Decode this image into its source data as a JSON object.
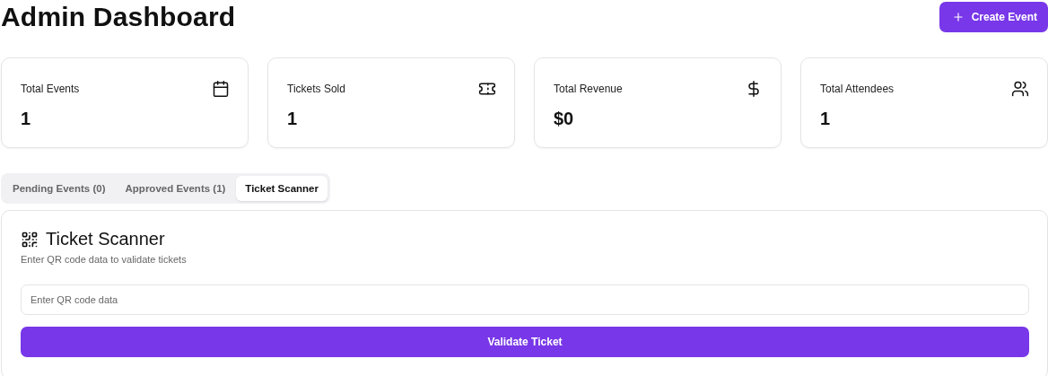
{
  "header": {
    "title": "Admin Dashboard",
    "create_button": "Create Event"
  },
  "stats": [
    {
      "label": "Total Events",
      "value": "1"
    },
    {
      "label": "Tickets Sold",
      "value": "1"
    },
    {
      "label": "Total Revenue",
      "value": "$0"
    },
    {
      "label": "Total Attendees",
      "value": "1"
    }
  ],
  "tabs": [
    {
      "label": "Pending Events (0)",
      "selected": false
    },
    {
      "label": "Approved Events (1)",
      "selected": false
    },
    {
      "label": "Ticket Scanner",
      "selected": true
    }
  ],
  "scanner": {
    "title": "Ticket Scanner",
    "subtitle": "Enter QR code data to validate tickets",
    "placeholder": "Enter QR code data",
    "button": "Validate Ticket"
  }
}
